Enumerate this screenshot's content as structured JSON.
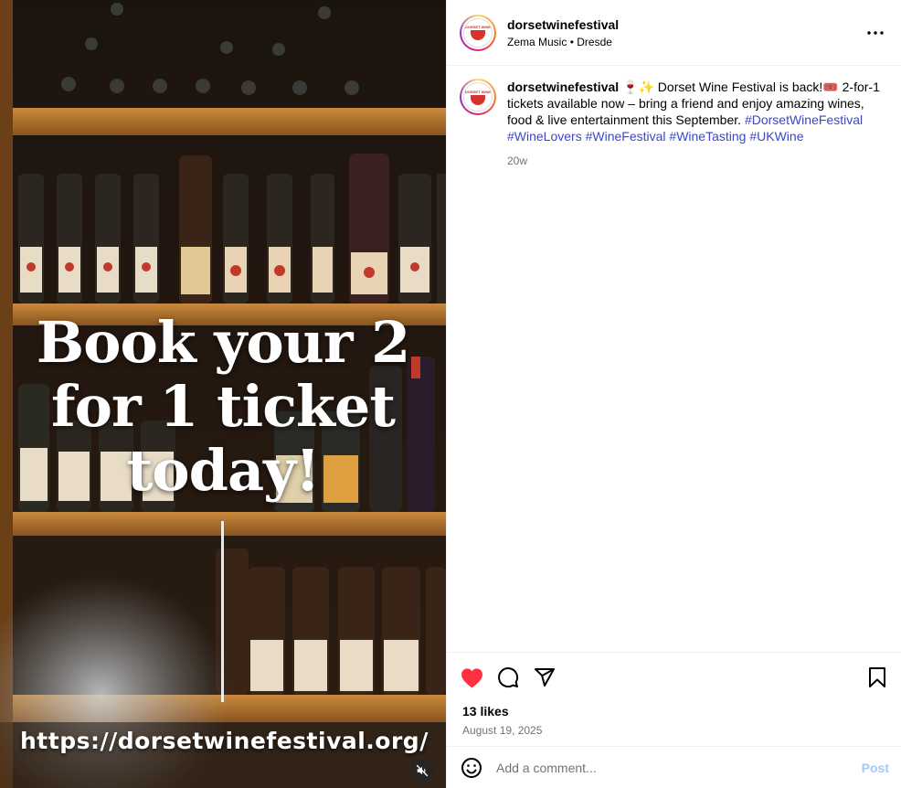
{
  "media": {
    "overlay_line1": "Book your 2",
    "overlay_line2": "for 1 ticket",
    "overlay_line3": "today!",
    "url_text": "https://dorsetwinefestival.org/",
    "mute_icon": "speaker-muted-icon"
  },
  "header": {
    "username": "dorsetwinefestival",
    "audio": "Zema Music",
    "separator": "•",
    "location": "Dresde",
    "avatar_text": "DORSET WINE"
  },
  "caption": {
    "username": "dorsetwinefestival",
    "emoji": "🍷✨",
    "text1": " Dorset Wine Festival is back!",
    "emoji2": "🎟️",
    "text2": " 2-for-1 tickets available now – bring a friend and enjoy amazing wines, food & live entertainment this September. ",
    "hashtags": [
      "#DorsetWineFestival",
      "#WineLovers",
      "#WineFestival",
      "#WineTasting",
      "#UKWine"
    ],
    "time": "20w"
  },
  "actions": {
    "likes": "13 likes",
    "date": "August 19, 2025",
    "like_icon": "heart-filled-icon",
    "comment_icon": "comment-icon",
    "share_icon": "share-icon",
    "save_icon": "bookmark-icon"
  },
  "comment": {
    "placeholder": "Add a comment...",
    "post_label": "Post"
  },
  "colors": {
    "like": "#ff3040",
    "hashtag": "#3b47c8",
    "muted": "#737373",
    "post": "#a7c7f1"
  }
}
